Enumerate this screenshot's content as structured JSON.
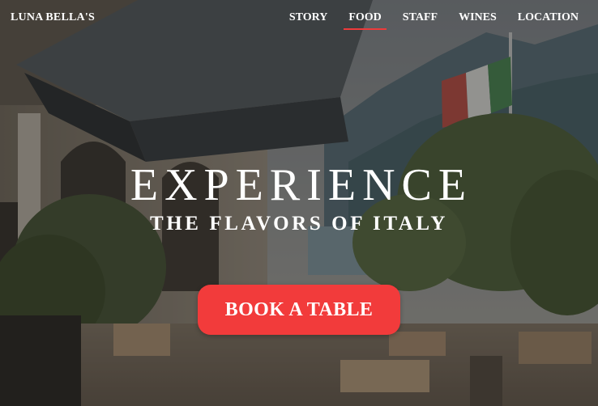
{
  "brand": {
    "name": "LUNA BELLA'S"
  },
  "nav": {
    "items": [
      {
        "label": "STORY",
        "active": false
      },
      {
        "label": "FOOD",
        "active": true
      },
      {
        "label": "STAFF",
        "active": false
      },
      {
        "label": "WINES",
        "active": false
      },
      {
        "label": "LOCATION",
        "active": false
      }
    ]
  },
  "hero": {
    "headline": "EXPERIENCE",
    "subheadline": "THE FLAVORS OF ITALY",
    "cta_label": "BOOK A TABLE",
    "background": "restaurant-terrace-photo"
  },
  "colors": {
    "accent": "#f23b3b",
    "text": "#ffffff",
    "overlay": "#141210"
  }
}
